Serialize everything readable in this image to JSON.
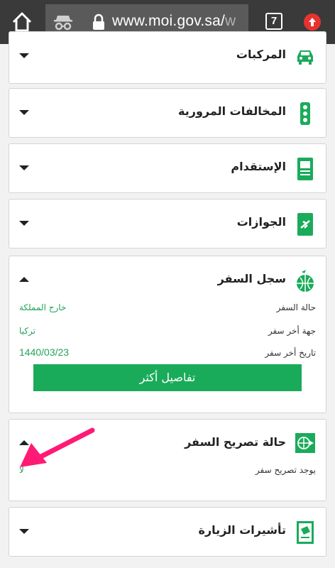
{
  "browser": {
    "url_main": "www.moi.gov.sa/",
    "url_tail": "w",
    "tab_count": "7"
  },
  "sections": {
    "vehicles": {
      "title": "المركبات",
      "icon": "car-icon"
    },
    "traffic": {
      "title": "المخالفات المرورية",
      "icon": "traffic-light-icon"
    },
    "recruitment": {
      "title": "الإستقدام",
      "icon": "document-id-icon"
    },
    "passports": {
      "title": "الجوازات",
      "icon": "passport-plane-icon"
    },
    "travel_record": {
      "title": "سجل السفر",
      "icon": "globe-plane-icon",
      "rows": [
        {
          "label": "حالة السفر",
          "value": "خارج المملكة"
        },
        {
          "label": "جهة أخر سفر",
          "value": "تركيا"
        },
        {
          "label": "تاريخ أخر سفر",
          "value": "1440/03/23"
        }
      ],
      "more_button": "تفاصيل أكثر"
    },
    "travel_permit": {
      "title": "حالة تصريح السفر",
      "icon": "globe-arrow-icon",
      "rows": [
        {
          "label": "يوجد تصريح سفر",
          "value": "لا"
        }
      ]
    },
    "visit_visas": {
      "title": "تأشيرات الزيارة",
      "icon": "visa-document-icon"
    }
  },
  "annotation": {
    "color": "#ff1a75",
    "icon": "pink-arrow-icon"
  },
  "colors": {
    "accent": "#1aab5a",
    "toolbar": "#3a3a3a"
  }
}
